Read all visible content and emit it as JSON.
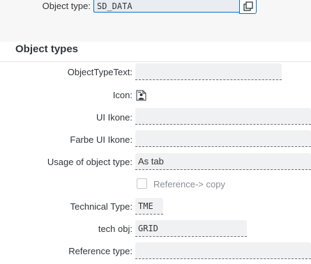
{
  "header": {
    "object_type_label": "Object type:",
    "object_type_value": "SD_DATA",
    "value_help_icon": "value-help-icon"
  },
  "section": {
    "title": "Object types"
  },
  "form": {
    "object_type_text_label": "ObjectTypeText:",
    "object_type_text_value": "",
    "icon_label": "Icon:",
    "icon_name": "person-document-icon",
    "ui_ikone_label": "UI Ikone:",
    "ui_ikone_value": "",
    "farbe_ui_ikone_label": "Farbe UI Ikone:",
    "farbe_ui_ikone_value": "",
    "usage_label": "Usage of object type:",
    "usage_value": "As tab",
    "reference_copy_label": "Reference-> copy",
    "reference_copy_checked": false,
    "technical_type_label": "Technical Type:",
    "technical_type_value": "TME",
    "tech_obj_label": "tech obj:",
    "tech_obj_value": "GRID",
    "reference_type_label": "Reference type:",
    "reference_type_value": ""
  },
  "colors": {
    "accent": "#0a6ed1",
    "field_bg": "#eff1f2",
    "text": "#32363a",
    "muted": "#8a8e92"
  }
}
